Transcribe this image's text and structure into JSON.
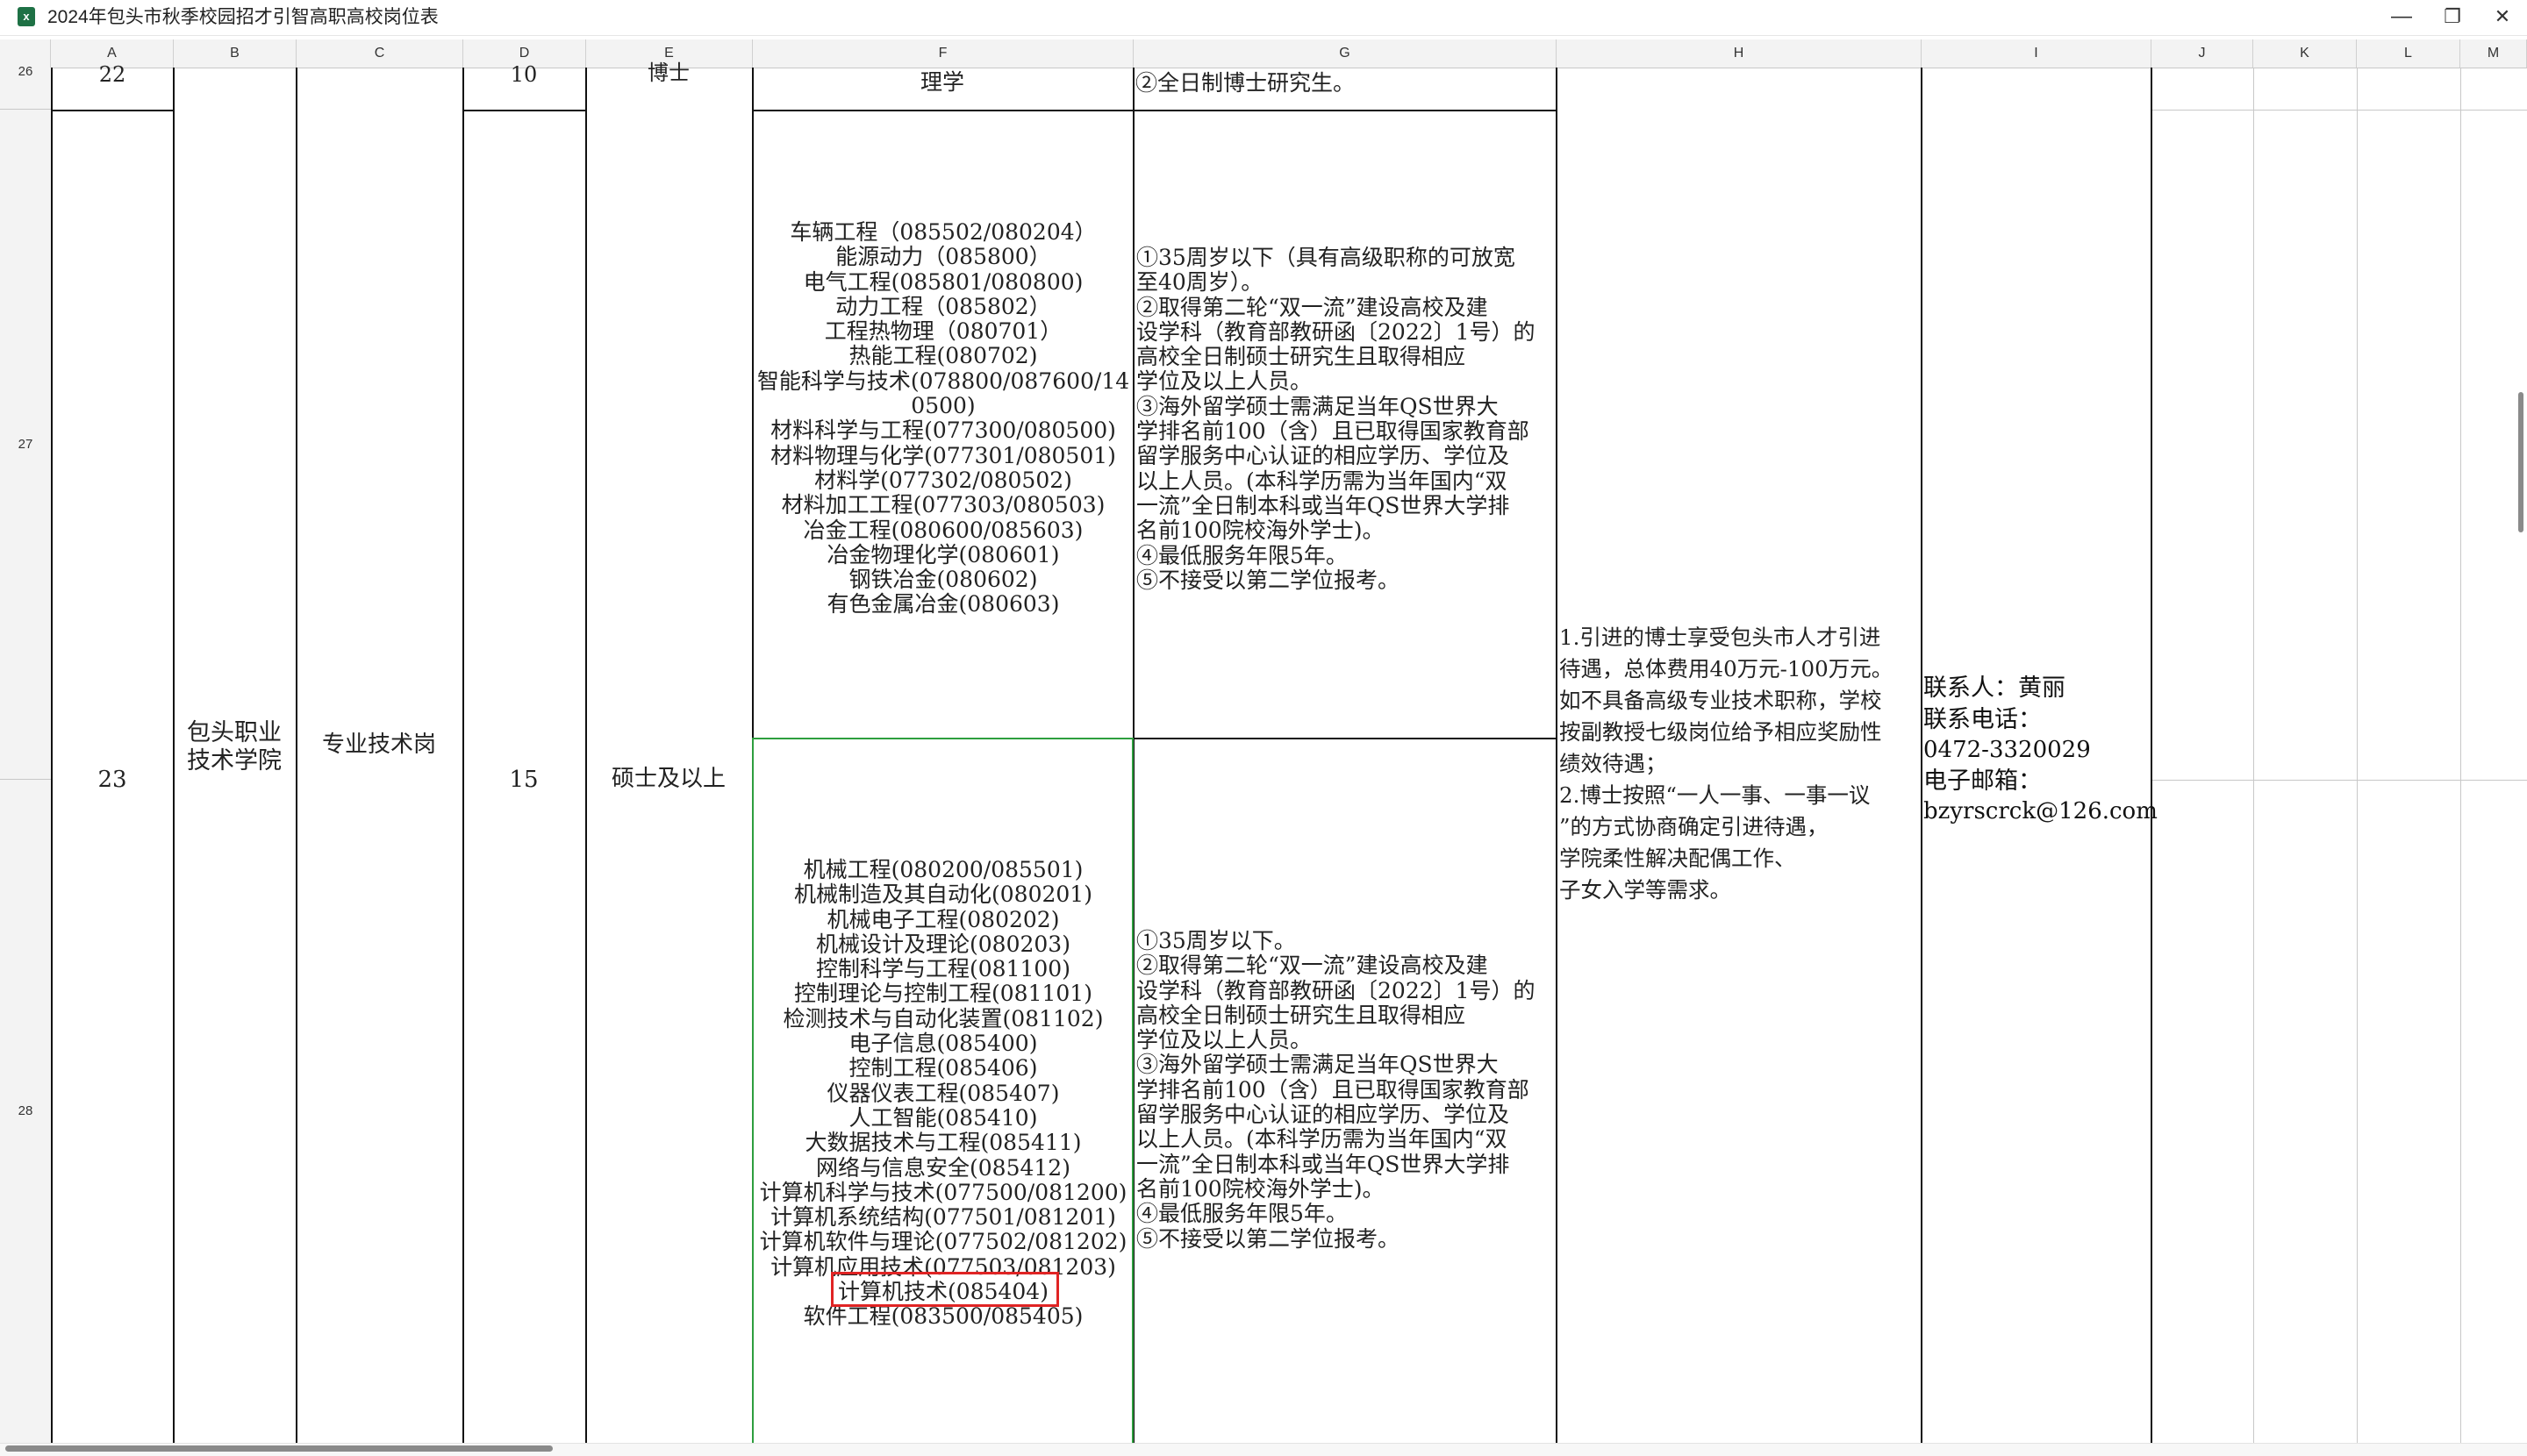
{
  "window": {
    "app_icon": "excel-icon",
    "title": "2024年包头市秋季校园招才引智高职高校岗位表",
    "buttons": {
      "minimize": "—",
      "restore": "❐",
      "close": "✕"
    }
  },
  "columns": [
    "A",
    "B",
    "C",
    "D",
    "E",
    "F",
    "G",
    "H",
    "I",
    "J",
    "K",
    "L",
    "M"
  ],
  "rows": [
    "26",
    "27",
    "28"
  ],
  "row26": {
    "seq": "22",
    "count": "10",
    "degree": "博士",
    "major_tail": "理学",
    "req_tail": "②全日制博士研究生。"
  },
  "merged": {
    "seq": "23",
    "school": [
      "包头职业",
      "技术学院"
    ],
    "post_type": "专业技术岗",
    "count": "15",
    "degree": "硕士及以上",
    "benefits": [
      "1.引进的博士享受包头市人才引进",
      "待遇，总体费用40万元-100万元。",
      "如不具备高级专业技术职称，学校",
      "按副教授七级岗位给予相应奖励性",
      "绩效待遇；",
      "2.博士按照“一人一事、一事一议",
      "”的方式协商确定引进待遇，",
      "学院柔性解决配偶工作、",
      "子女入学等需求。"
    ],
    "contact": {
      "person_label": "联系人：",
      "person": "黄丽",
      "phone_label": "联系电话：",
      "phone": "0472-3320029",
      "email_label": "电子邮箱：",
      "email": "bzyrscrck@126.com"
    }
  },
  "row27": {
    "majors": [
      "车辆工程（085502/080204）",
      "能源动力（085800）",
      "电气工程(085801/080800)",
      "动力工程（085802）",
      "工程热物理（080701）",
      "热能工程(080702)",
      "智能科学与技术(078800/087600/14",
      "0500)",
      "材料科学与工程(077300/080500)",
      "材料物理与化学(077301/080501)",
      "材料学(077302/080502)",
      "材料加工工程(077303/080503)",
      "冶金工程(080600/085603)",
      "冶金物理化学(080601)",
      "钢铁冶金(080602)",
      "有色金属冶金(080603)"
    ],
    "requirements": [
      "①35周岁以下（具有高级职称的可放宽",
      "至40周岁）。",
      "②取得第二轮“双一流”建设高校及建",
      "设学科（教育部教研函〔2022〕1号）的",
      "高校全日制硕士研究生且取得相应",
      "学位及以上人员。",
      "③海外留学硕士需满足当年QS世界大",
      "学排名前100（含）且已取得国家教育部",
      "留学服务中心认证的相应学历、学位及",
      "以上人员。(本科学历需为当年国内“双",
      "一流”全日制本科或当年QS世界大学排",
      "名前100院校海外学士)。",
      "④最低服务年限5年。",
      "⑤不接受以第二学位报考。"
    ]
  },
  "row28": {
    "majors": [
      "机械工程(080200/085501)",
      "机械制造及其自动化(080201)",
      "机械电子工程(080202)",
      "机械设计及理论(080203)",
      "控制科学与工程(081100)",
      "控制理论与控制工程(081101)",
      "检测技术与自动化装置(081102)",
      "电子信息(085400)",
      "控制工程(085406)",
      "仪器仪表工程(085407)",
      "人工智能(085410)",
      "大数据技术与工程(085411)",
      "网络与信息安全(085412)",
      "计算机科学与技术(077500/081200)",
      "计算机系统结构(077501/081201)",
      "计算机软件与理论(077502/081202)",
      "计算机应用技术(077503/081203)",
      "计算机技术(085404)",
      "软件工程(083500/085405)"
    ],
    "highlighted_major": "计算机技术(085404)",
    "requirements": [
      "①35周岁以下。",
      "②取得第二轮“双一流”建设高校及建",
      "设学科（教育部教研函〔2022〕1号）的",
      "高校全日制硕士研究生且取得相应",
      "学位及以上人员。",
      "③海外留学硕士需满足当年QS世界大",
      "学排名前100（含）且已取得国家教育部",
      "留学服务中心认证的相应学历、学位及",
      "以上人员。(本科学历需为当年国内“双",
      "一流”全日制本科或当年QS世界大学排",
      "名前100院校海外学士)。",
      "④最低服务年限5年。",
      "⑤不接受以第二学位报考。"
    ]
  },
  "colors": {
    "grid_line": "#111111",
    "selection_green": "#2e9e3e",
    "highlight_red": "#e02424",
    "header_bg": "#f3f3f3"
  }
}
